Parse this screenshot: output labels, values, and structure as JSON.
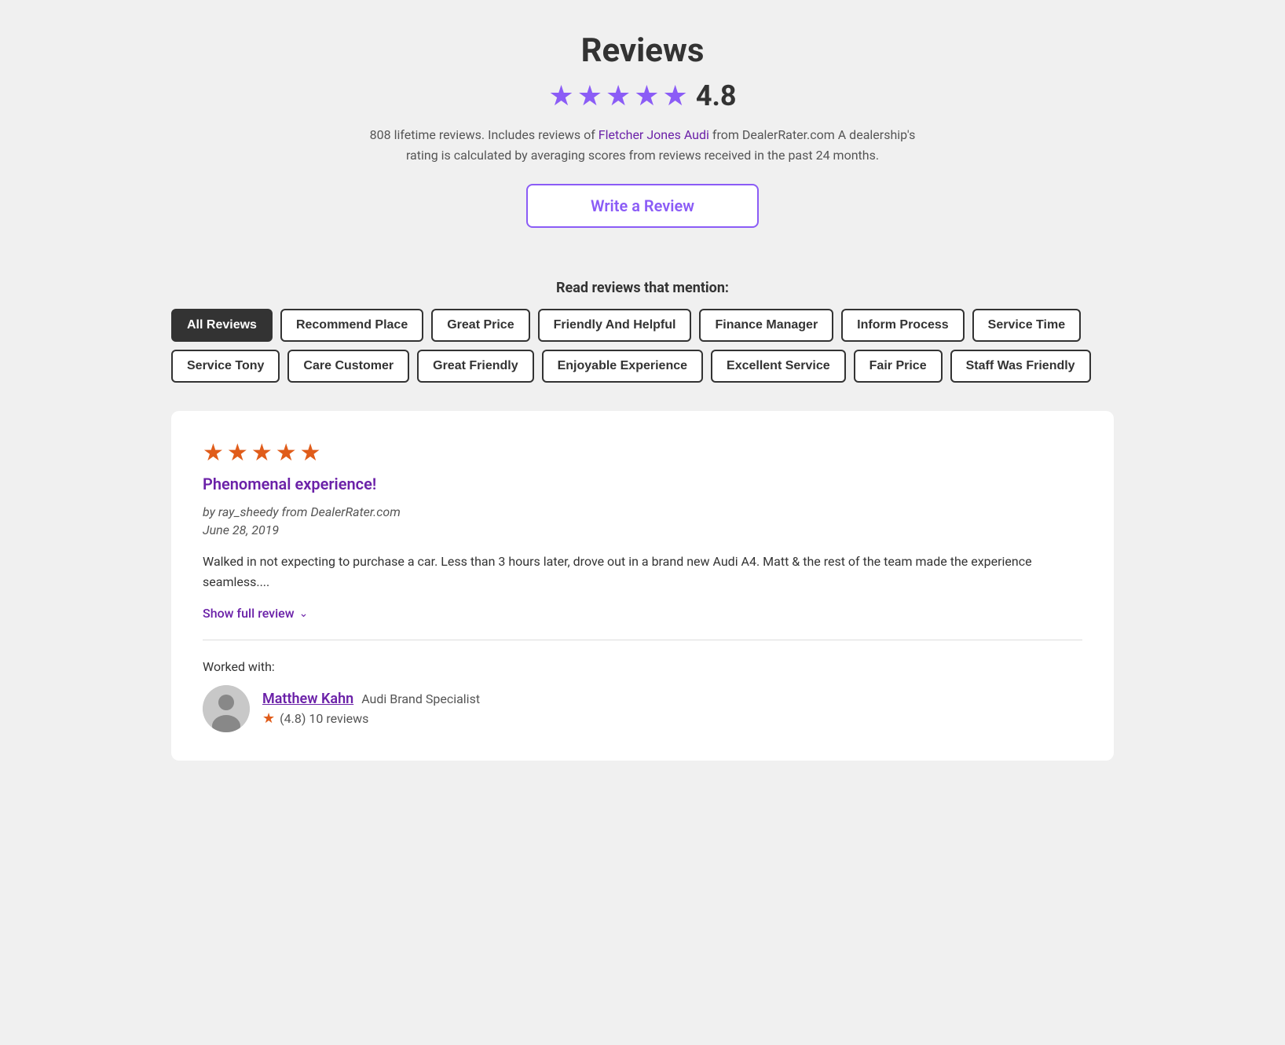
{
  "header": {
    "title": "Reviews",
    "rating": "4.8",
    "stars_count": 4.8,
    "lifetime_reviews": "808 lifetime reviews. Includes reviews of",
    "dealer_link_text": "Fletcher Jones Audi",
    "description_suffix": "from DealerRater.com A dealership's rating is calculated by averaging scores from reviews received in the past 24 months.",
    "write_review_label": "Write a Review"
  },
  "tags_section": {
    "title": "Read reviews that mention:",
    "tags": [
      {
        "id": "all-reviews",
        "label": "All Reviews",
        "active": true
      },
      {
        "id": "recommend-place",
        "label": "Recommend Place",
        "active": false
      },
      {
        "id": "great-price",
        "label": "Great Price",
        "active": false
      },
      {
        "id": "friendly-helpful",
        "label": "Friendly And Helpful",
        "active": false
      },
      {
        "id": "finance-manager",
        "label": "Finance Manager",
        "active": false
      },
      {
        "id": "inform-process",
        "label": "Inform Process",
        "active": false
      },
      {
        "id": "service-time",
        "label": "Service Time",
        "active": false
      },
      {
        "id": "service-tony",
        "label": "Service Tony",
        "active": false
      },
      {
        "id": "care-customer",
        "label": "Care Customer",
        "active": false
      },
      {
        "id": "great-friendly",
        "label": "Great Friendly",
        "active": false
      },
      {
        "id": "enjoyable-experience",
        "label": "Enjoyable Experience",
        "active": false
      },
      {
        "id": "excellent-service",
        "label": "Excellent Service",
        "active": false
      },
      {
        "id": "fair-price",
        "label": "Fair Price",
        "active": false
      },
      {
        "id": "staff-was-friendly",
        "label": "Staff Was Friendly",
        "active": false
      }
    ]
  },
  "reviews": [
    {
      "id": "review-1",
      "stars": 5,
      "title": "Phenomenal experience!",
      "author": "ray_sheedy",
      "source": "DealerRater.com",
      "date": "June 28, 2019",
      "text": "Walked in not expecting to purchase a car. Less than 3 hours later, drove out in a brand new Audi A4. Matt & the rest of the team made the experience seamless....",
      "show_full_label": "Show full review",
      "worked_with_label": "Worked with:",
      "staff": [
        {
          "name": "Matthew Kahn",
          "title": "Audi Brand Specialist",
          "rating": "(4.8)",
          "review_count": "10 reviews"
        }
      ]
    }
  ],
  "icons": {
    "star_filled": "★",
    "chevron_down": "∨",
    "person": "👤"
  }
}
